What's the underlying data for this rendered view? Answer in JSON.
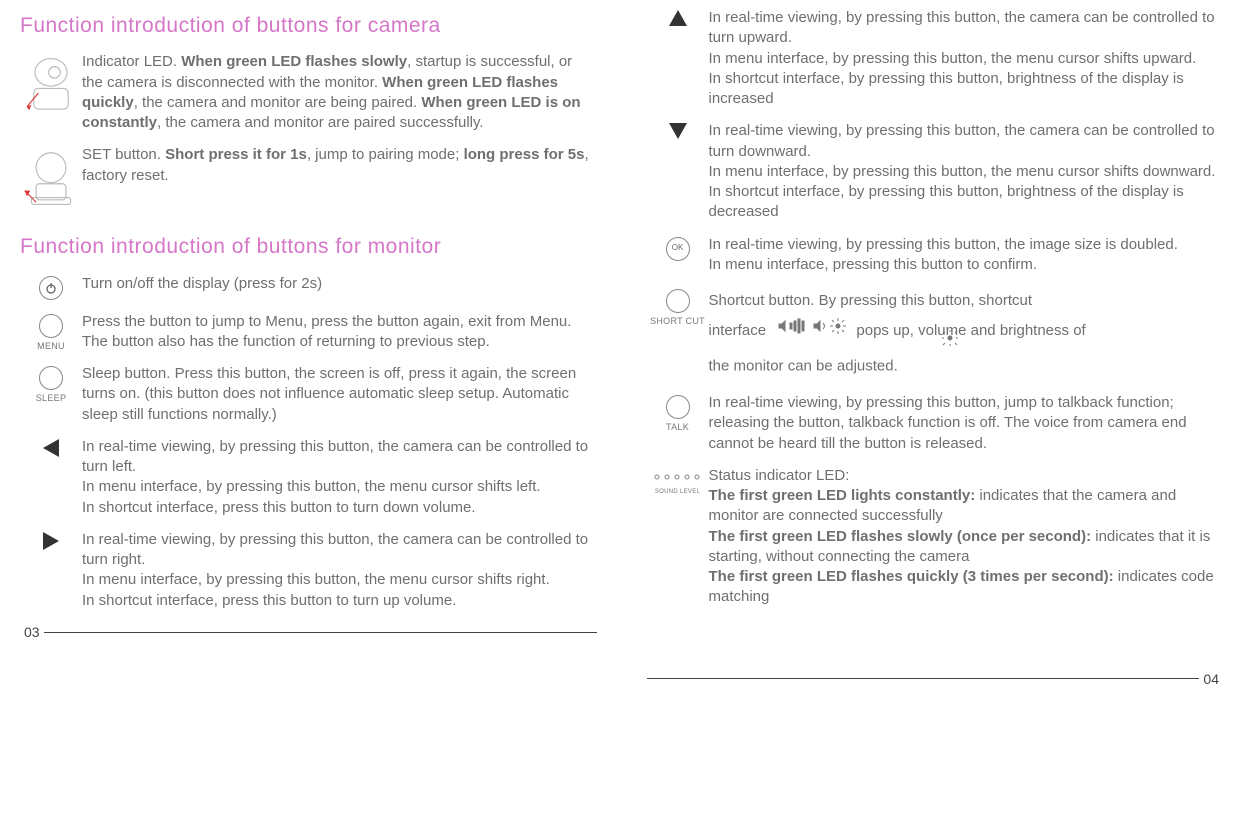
{
  "left": {
    "heading_camera": "Function introduction of buttons for camera",
    "cam_led_pre": "Indicator LED. ",
    "cam_led_b1": "When green LED flashes slowly",
    "cam_led_t1": ", startup is successful, or the camera is disconnected with the monitor. ",
    "cam_led_b2": "When green LED flashes quickly",
    "cam_led_t2": ", the camera and monitor are being paired. ",
    "cam_led_b3": "When green LED is on constantly",
    "cam_led_t3": ", the camera and monitor are paired successfully.",
    "cam_set_pre": "SET button. ",
    "cam_set_b1": "Short press it for 1s",
    "cam_set_t1": ", jump to pairing mode; ",
    "cam_set_b2": "long press for 5s",
    "cam_set_t2": ", factory reset.",
    "heading_monitor": "Function introduction of buttons for monitor",
    "power": "Turn on/off the display (press for 2s)",
    "menu_label": "MENU",
    "menu": "Press the button to jump to Menu, press the button again, exit from Menu. The button also has the function of returning to previous step.",
    "sleep_label": "SLEEP",
    "sleep": "Sleep button. Press this button, the screen is off, press it again, the screen turns on. (this button does not influence automatic sleep setup. Automatic sleep still functions normally.)",
    "left_a": "In real-time viewing, by pressing this button, the camera can be controlled to turn left.",
    "left_b": "In menu interface, by pressing this button, the menu cursor shifts left.",
    "left_c": "In shortcut interface, press this button to turn down volume.",
    "right_a": "In real-time viewing, by pressing this button, the camera can be controlled to turn right.",
    "right_b": "In menu interface, by pressing this button, the menu cursor shifts right.",
    "right_c": "In shortcut interface, press this button to turn up volume.",
    "page": "03"
  },
  "right": {
    "up_a": "In real-time viewing, by pressing this button, the camera can be controlled to turn upward.",
    "up_b": "In menu interface, by pressing this button, the menu cursor shifts upward.",
    "up_c": "In shortcut interface, by pressing this button, brightness of the display is increased",
    "down_a": "In real-time viewing, by pressing this button, the camera can be controlled to turn downward.",
    "down_b": "In menu interface, by pressing this button, the menu cursor shifts downward.",
    "down_c": "In shortcut interface, by pressing this button, brightness of the display is decreased",
    "ok_label": "OK",
    "ok_a": "In real-time viewing, by pressing this button, the image size is doubled.",
    "ok_b": "In menu interface, pressing this button to confirm.",
    "shortcut_label": "SHORT CUT",
    "shortcut_a": "Shortcut button. By pressing this button, shortcut",
    "shortcut_b": "interface",
    "shortcut_c": "pops up, volume and brightness of",
    "shortcut_d": "the monitor can be adjusted.",
    "talk_label": "TALK",
    "talk": "In real-time viewing, by pressing this button, jump to talkback function; releasing the button, talkback function is off. The voice from camera end cannot be heard till the button is released.",
    "sound_label": "SOUND LEVEL",
    "status_head": "Status indicator LED:",
    "status_b1": "The first green LED lights constantly:",
    "status_t1": " indicates that the camera and monitor are connected successfully",
    "status_b2": "The first green LED flashes slowly (once per second):",
    "status_t2": " indicates that it is starting, without connecting the camera",
    "status_b3": "The first green LED flashes quickly (3 times per second):",
    "status_t3": " indicates code matching",
    "page": "04"
  }
}
